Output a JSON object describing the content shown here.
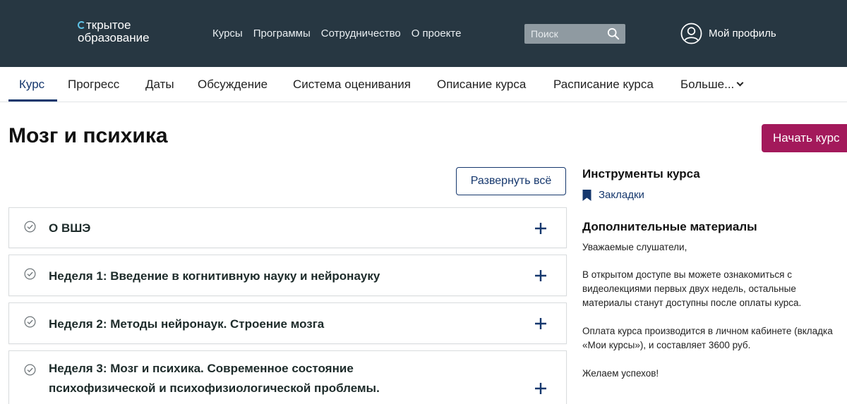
{
  "header": {
    "logo_line1": "ткрытое",
    "logo_line2": "образование",
    "nav": [
      "Курсы",
      "Программы",
      "Сотрудничество",
      "О проекте"
    ],
    "search_placeholder": "Поиск",
    "profile_label": "Мой профиль",
    "bg_color": "#273742"
  },
  "tabs": [
    {
      "label": "Курс",
      "active": true
    },
    {
      "label": "Прогресс"
    },
    {
      "label": "Даты"
    },
    {
      "label": "Обсуждение"
    },
    {
      "label": "Система оценивания"
    },
    {
      "label": "Описание курса"
    },
    {
      "label": "Расписание курса"
    },
    {
      "label": "Больше..."
    }
  ],
  "course": {
    "title": "Мозг и психика",
    "start_button": "Начать курс",
    "expand_all": "Развернуть всё",
    "accent_color": "#a3195b"
  },
  "sections": [
    {
      "title": "О ВШЭ"
    },
    {
      "title": "Неделя 1: Введение в когнитивную науку и нейронауку"
    },
    {
      "title": "Неделя 2: Методы нейронаук. Строение мозга"
    },
    {
      "title": "Неделя 3: Мозг и психика. Современное состояние психофизической и психофизиологической проблемы."
    }
  ],
  "sidebar": {
    "tools_heading": "Инструменты курса",
    "bookmarks": "Закладки",
    "materials_heading": "Дополнительные материалы",
    "paragraphs": [
      "Уважаемые слушатели,",
      "В открытом доступе вы можете ознакомиться с",
      "видеолекциями первых двух недель, остальные",
      "материалы станут доступны после оплаты курса.",
      "Оплата курса производится в личном кабинете (вкладка",
      "«Мои курсы»), и составляет 3600 руб.",
      "Желаем успехов!"
    ]
  }
}
